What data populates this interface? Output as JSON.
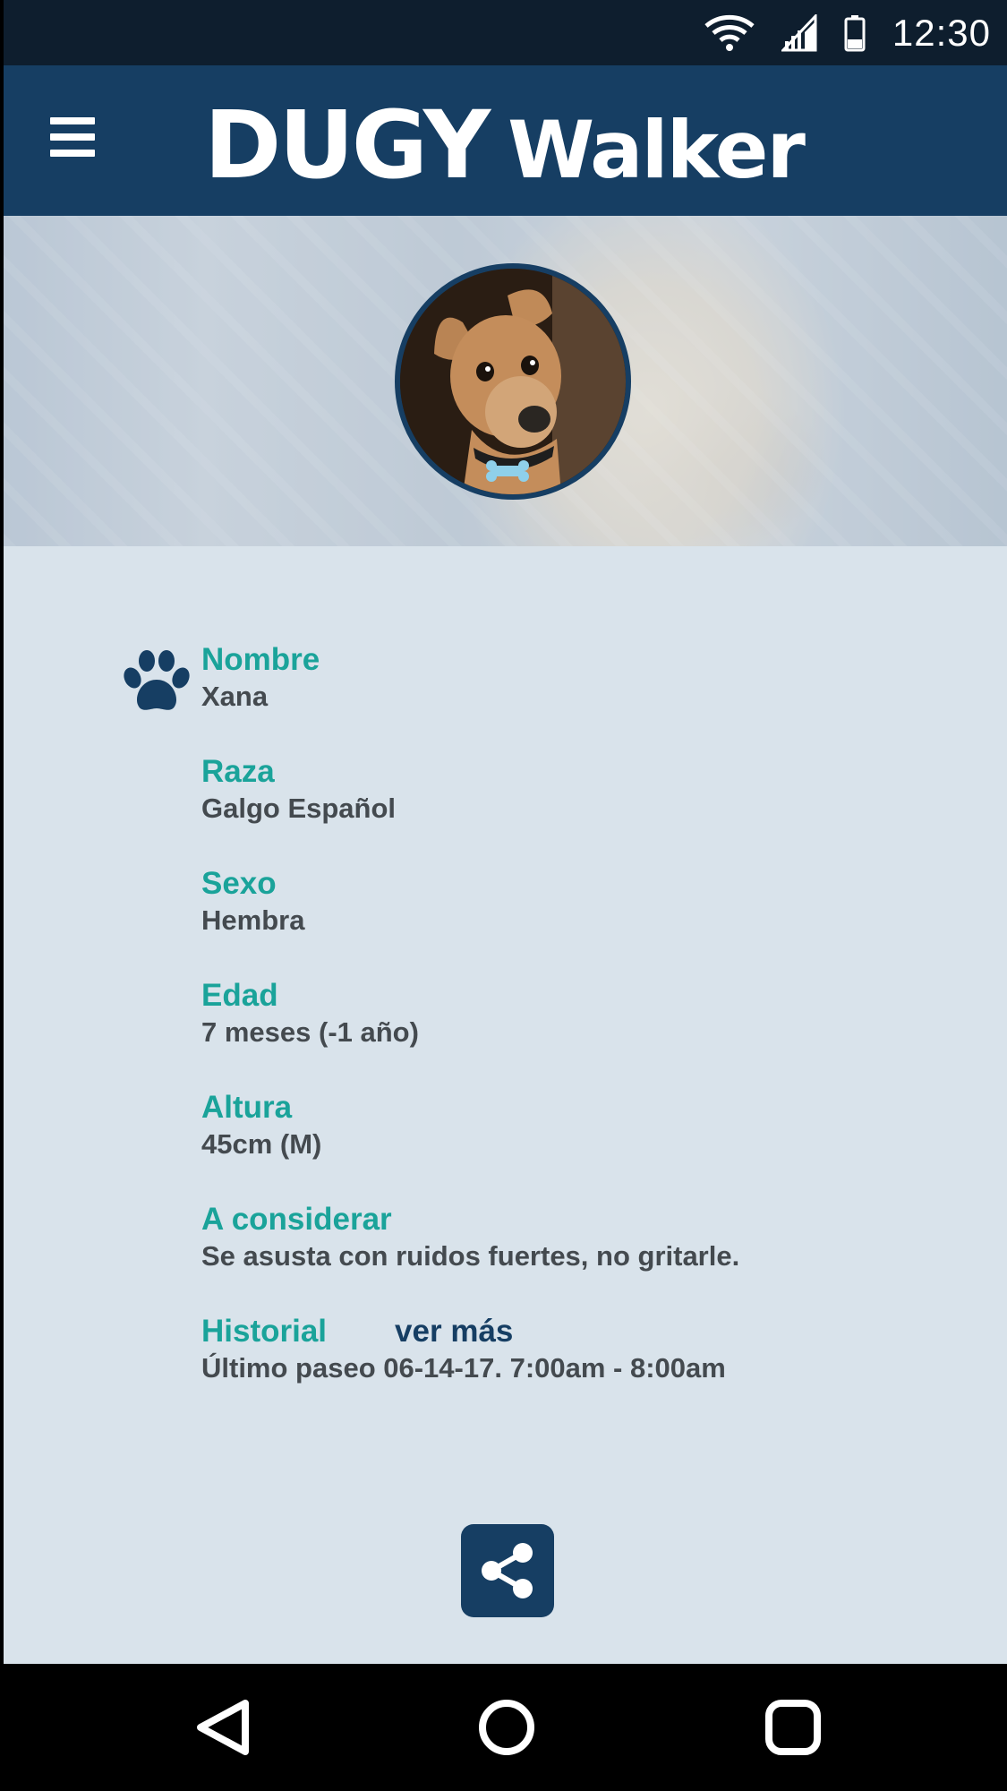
{
  "status_bar": {
    "time": "12:30"
  },
  "app_bar": {
    "brand": "DUGY",
    "subtitle": "Walker"
  },
  "pet": {
    "fields": [
      {
        "label": "Nombre",
        "value": "Xana"
      },
      {
        "label": "Raza",
        "value": "Galgo Español"
      },
      {
        "label": "Sexo",
        "value": "Hembra"
      },
      {
        "label": "Edad",
        "value": "7 meses (-1 año)"
      },
      {
        "label": "Altura",
        "value": "45cm (M)"
      },
      {
        "label": "A considerar",
        "value": "Se asusta con ruidos fuertes, no gritarle."
      }
    ],
    "history": {
      "label": "Historial",
      "link": "ver más",
      "value": "Último paseo 06-14-17. 7:00am - 8:00am"
    }
  },
  "colors": {
    "header": "#163e63",
    "status_bar": "#0e1e2e",
    "accent_label": "#1aa39a",
    "content_bg": "#d9e3eb",
    "value_text": "#444a4f"
  },
  "icons": {
    "menu": "menu-icon",
    "wifi": "wifi-icon",
    "signal": "signal-icon",
    "battery": "battery-icon",
    "paw": "paw-icon",
    "share": "share-icon",
    "back": "back-icon",
    "home": "home-icon",
    "recents": "recents-icon"
  }
}
